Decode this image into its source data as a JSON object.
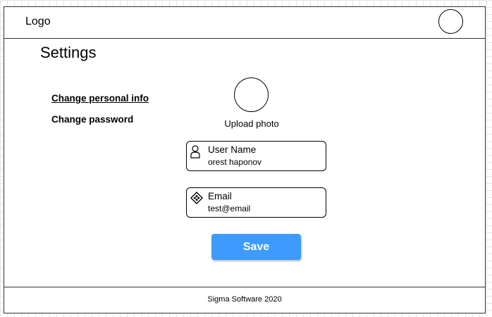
{
  "header": {
    "logo_text": "Logo",
    "avatar_icon": "user-avatar-circle"
  },
  "page": {
    "title": "Settings"
  },
  "sidebar": {
    "items": [
      {
        "label": "Change personal info",
        "active": true
      },
      {
        "label": "Change password",
        "active": false
      }
    ]
  },
  "profile_photo": {
    "upload_label": "Upload photo"
  },
  "form": {
    "user_name": {
      "label": "User Name",
      "value": "orest haponov",
      "icon": "user-icon"
    },
    "email": {
      "label": "Email",
      "value": "test@email",
      "icon": "email-diamond-icon"
    },
    "save_label": "Save"
  },
  "footer": {
    "text": "Sigma Software 2020"
  },
  "colors": {
    "accent": "#3d9bff",
    "border": "#333333"
  }
}
